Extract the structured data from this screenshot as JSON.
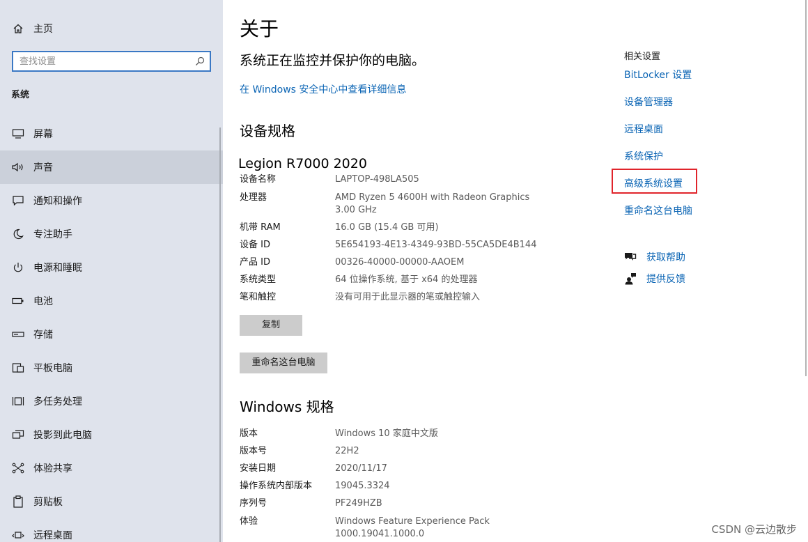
{
  "sidebar": {
    "home_label": "主页",
    "search_placeholder": "查找设置",
    "section_label": "系统",
    "items": [
      {
        "label": "屏幕",
        "icon": "monitor-icon"
      },
      {
        "label": "声音",
        "icon": "speaker-icon"
      },
      {
        "label": "通知和操作",
        "icon": "notification-icon"
      },
      {
        "label": "专注助手",
        "icon": "moon-icon"
      },
      {
        "label": "电源和睡眠",
        "icon": "power-icon"
      },
      {
        "label": "电池",
        "icon": "battery-icon"
      },
      {
        "label": "存储",
        "icon": "storage-icon"
      },
      {
        "label": "平板电脑",
        "icon": "tablet-icon"
      },
      {
        "label": "多任务处理",
        "icon": "multitask-icon"
      },
      {
        "label": "投影到此电脑",
        "icon": "project-icon"
      },
      {
        "label": "体验共享",
        "icon": "share-icon"
      },
      {
        "label": "剪贴板",
        "icon": "clipboard-icon"
      },
      {
        "label": "远程桌面",
        "icon": "remote-desktop-icon"
      }
    ],
    "active_index": 1
  },
  "main": {
    "title": "关于",
    "protect_text": "系统正在监控并保护你的电脑。",
    "security_link": "在 Windows 安全中心中查看详细信息",
    "device_specs_heading": "设备规格",
    "device_name": "Legion R7000 2020",
    "device_specs": [
      {
        "key": "设备名称",
        "value": "LAPTOP-498LA505"
      },
      {
        "key": "处理器",
        "value": "AMD Ryzen 5 4600H with Radeon Graphics",
        "value2": "3.00 GHz"
      },
      {
        "key": "机带 RAM",
        "value": "16.0 GB (15.4 GB 可用)"
      },
      {
        "key": "设备 ID",
        "value": "5E654193-4E13-4349-93BD-55CA5DE4B144"
      },
      {
        "key": "产品 ID",
        "value": "00326-40000-00000-AAOEM"
      },
      {
        "key": "系统类型",
        "value": "64 位操作系统, 基于 x64 的处理器"
      },
      {
        "key": "笔和触控",
        "value": "没有可用于此显示器的笔或触控输入"
      }
    ],
    "copy_button": "复制",
    "rename_button": "重命名这台电脑",
    "windows_specs_heading": "Windows 规格",
    "windows_specs": [
      {
        "key": "版本",
        "value": "Windows 10 家庭中文版"
      },
      {
        "key": "版本号",
        "value": "22H2"
      },
      {
        "key": "安装日期",
        "value": "2020/11/17"
      },
      {
        "key": "操作系统内部版本",
        "value": "19045.3324"
      },
      {
        "key": "序列号",
        "value": "PF249HZB"
      },
      {
        "key": "体验",
        "value": "Windows Feature Experience Pack",
        "value2": "1000.19041.1000.0"
      }
    ]
  },
  "related": {
    "title": "相关设置",
    "links": [
      "BitLocker 设置",
      "设备管理器",
      "远程桌面",
      "系统保护",
      "高级系统设置",
      "重命名这台电脑"
    ],
    "highlighted_index": 4,
    "help": [
      {
        "label": "获取帮助",
        "icon": "help-chat-icon"
      },
      {
        "label": "提供反馈",
        "icon": "feedback-icon"
      }
    ]
  },
  "watermark": "CSDN @云边散步",
  "colors": {
    "sidebar_bg": "#dfe3ec",
    "link": "#0a64b4",
    "search_border": "#3a78c4",
    "highlight_border": "#e0242b",
    "button_bg": "#cccccc"
  }
}
